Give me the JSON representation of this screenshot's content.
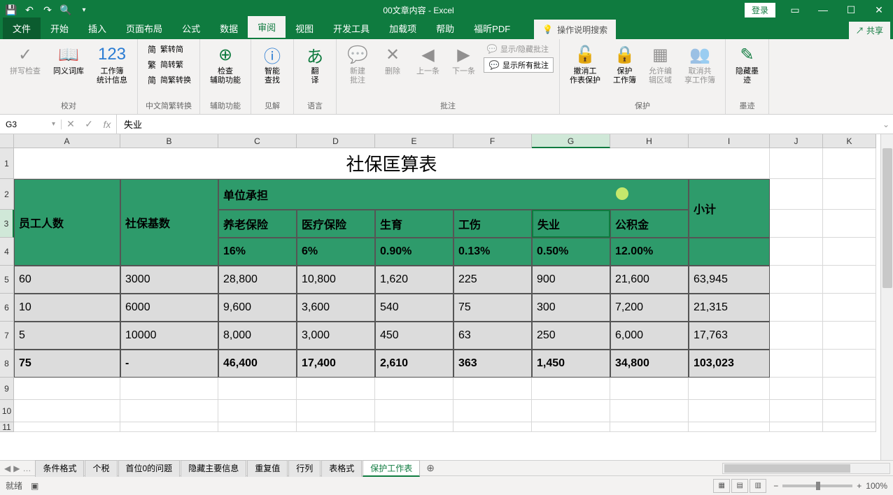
{
  "titlebar": {
    "title": "00文章内容 - Excel",
    "login": "登录"
  },
  "tabs": {
    "file": "文件",
    "home": "开始",
    "insert": "插入",
    "layout": "页面布局",
    "formulas": "公式",
    "data": "数据",
    "review": "审阅",
    "view": "视图",
    "dev": "开发工具",
    "addin": "加载项",
    "help": "帮助",
    "foxit": "福昕PDF",
    "tell": "操作说明搜索",
    "share": "共享"
  },
  "ribbon": {
    "proof": {
      "spell": "拼写检查",
      "thes": "同义词库",
      "stats": "工作簿\n统计信息",
      "group": "校对"
    },
    "cn": {
      "s2t": "繁转简",
      "t2s": "简转繁",
      "conv": "简繁转换",
      "group": "中文简繁转换"
    },
    "acc": {
      "check": "检查\n辅助功能",
      "group": "辅助功能"
    },
    "insights": {
      "smart": "智能\n查找",
      "group": "见解"
    },
    "lang": {
      "trans": "翻\n译",
      "group": "语言"
    },
    "comments": {
      "new": "新建\n批注",
      "del": "删除",
      "prev": "上一条",
      "next": "下一条",
      "showhide": "显示/隐藏批注",
      "showall": "显示所有批注",
      "group": "批注"
    },
    "protect": {
      "unsheet": "撤消工\n作表保护",
      "workbook": "保护\n工作簿",
      "range": "允许编\n辑区域",
      "unshare": "取消共\n享工作簿",
      "group": "保护"
    },
    "ink": {
      "hide": "隐藏墨\n迹",
      "group": "墨迹"
    }
  },
  "namebox": "G3",
  "formula": "失业",
  "colHeaders": [
    "A",
    "B",
    "C",
    "D",
    "E",
    "F",
    "G",
    "H",
    "I",
    "J",
    "K"
  ],
  "rowHeaders": [
    "1",
    "2",
    "3",
    "4",
    "5",
    "6",
    "7",
    "8",
    "9",
    "10",
    "11"
  ],
  "table": {
    "title": "社保匡算表",
    "h_emp": "员工人数",
    "h_base": "社保基数",
    "h_corp": "单位承担",
    "h_pension": "养老保险",
    "h_med": "医疗保险",
    "h_birth": "生育",
    "h_injury": "工伤",
    "h_unemp": "失业",
    "h_fund": "公积金",
    "h_sub": "小计",
    "r_pension": "16%",
    "r_med": "6%",
    "r_birth": "0.90%",
    "r_injury": "0.13%",
    "r_unemp": "0.50%",
    "r_fund": "12.00%",
    "rows": [
      {
        "emp": "60",
        "base": "3000",
        "c": "28,800",
        "d": "10,800",
        "e": "1,620",
        "f": "225",
        "g": "900",
        "h": "21,600",
        "i": "63,945"
      },
      {
        "emp": "10",
        "base": "6000",
        "c": "9,600",
        "d": "3,600",
        "e": "540",
        "f": "75",
        "g": "300",
        "h": "7,200",
        "i": "21,315"
      },
      {
        "emp": "5",
        "base": "10000",
        "c": "8,000",
        "d": "3,000",
        "e": "450",
        "f": "63",
        "g": "250",
        "h": "6,000",
        "i": "17,763"
      },
      {
        "emp": "75",
        "base": "-",
        "c": "46,400",
        "d": "17,400",
        "e": "2,610",
        "f": "363",
        "g": "1,450",
        "h": "34,800",
        "i": "103,023"
      }
    ]
  },
  "sheetTabs": [
    "条件格式",
    "个税",
    "首位0的问题",
    "隐藏主要信息",
    "重复值",
    "行列",
    "表格式",
    "保护工作表"
  ],
  "activeSheetTab": 7,
  "status": {
    "ready": "就绪",
    "zoom": "100%"
  }
}
